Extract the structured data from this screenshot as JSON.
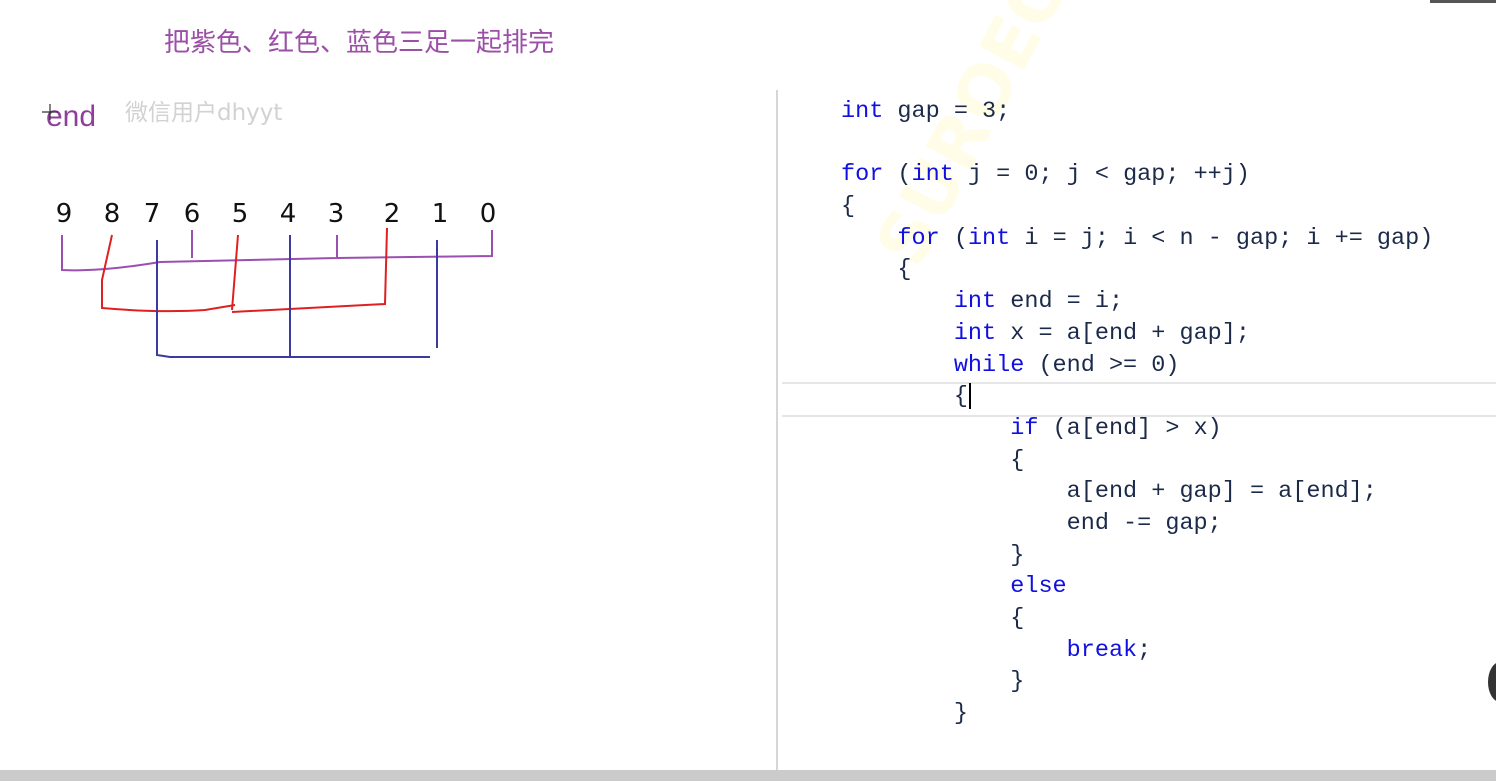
{
  "slide": {
    "title": "把紫色、红色、蓝色三足一起排完",
    "end_label": "end",
    "user_watermark": "微信用户dhyyt",
    "brand_watermark": "SUROEOY"
  },
  "diagram": {
    "numbers": [
      "9",
      "8",
      "7",
      "6",
      "5",
      "4",
      "3",
      "2",
      "1",
      "0"
    ],
    "groups": [
      {
        "color": "#9b4fb0",
        "members": [
          "9",
          "6",
          "3",
          "0"
        ]
      },
      {
        "color": "#e02020",
        "members": [
          "8",
          "5",
          "2"
        ]
      },
      {
        "color": "#3a3aa0",
        "members": [
          "7",
          "4",
          "1"
        ]
      }
    ]
  },
  "code": {
    "lines": [
      [
        {
          "k": 1,
          "t": "int"
        },
        {
          "t": " gap = 3;"
        }
      ],
      [
        {
          "t": ""
        }
      ],
      [
        {
          "k": 1,
          "t": "for"
        },
        {
          "t": " ("
        },
        {
          "k": 1,
          "t": "int"
        },
        {
          "t": " j = 0; j < gap; ++j)"
        }
      ],
      [
        {
          "t": "{"
        }
      ],
      [
        {
          "t": "    "
        },
        {
          "k": 1,
          "t": "for"
        },
        {
          "t": " ("
        },
        {
          "k": 1,
          "t": "int"
        },
        {
          "t": " i = j; i < n - gap; i += gap)"
        }
      ],
      [
        {
          "t": "    {"
        }
      ],
      [
        {
          "t": "        "
        },
        {
          "k": 1,
          "t": "int"
        },
        {
          "t": " end = i;"
        }
      ],
      [
        {
          "t": "        "
        },
        {
          "k": 1,
          "t": "int"
        },
        {
          "t": " x = a[end + gap];"
        }
      ],
      [
        {
          "t": "        "
        },
        {
          "k": 1,
          "t": "while"
        },
        {
          "t": " (end >= 0)"
        }
      ],
      [
        {
          "t": "        {"
        }
      ],
      [
        {
          "t": "            "
        },
        {
          "k": 1,
          "t": "if"
        },
        {
          "t": " (a[end] > x)"
        }
      ],
      [
        {
          "t": "            {"
        }
      ],
      [
        {
          "t": "                a[end + gap] = a[end];"
        }
      ],
      [
        {
          "t": "                end -= gap;"
        }
      ],
      [
        {
          "t": "            }"
        }
      ],
      [
        {
          "t": "            "
        },
        {
          "k": 1,
          "t": "else"
        }
      ],
      [
        {
          "t": "            {"
        }
      ],
      [
        {
          "t": "                "
        },
        {
          "k": 1,
          "t": "break"
        },
        {
          "t": ";"
        }
      ],
      [
        {
          "t": "            }"
        }
      ],
      [
        {
          "t": "        }"
        }
      ]
    ],
    "caret_line": 9
  }
}
